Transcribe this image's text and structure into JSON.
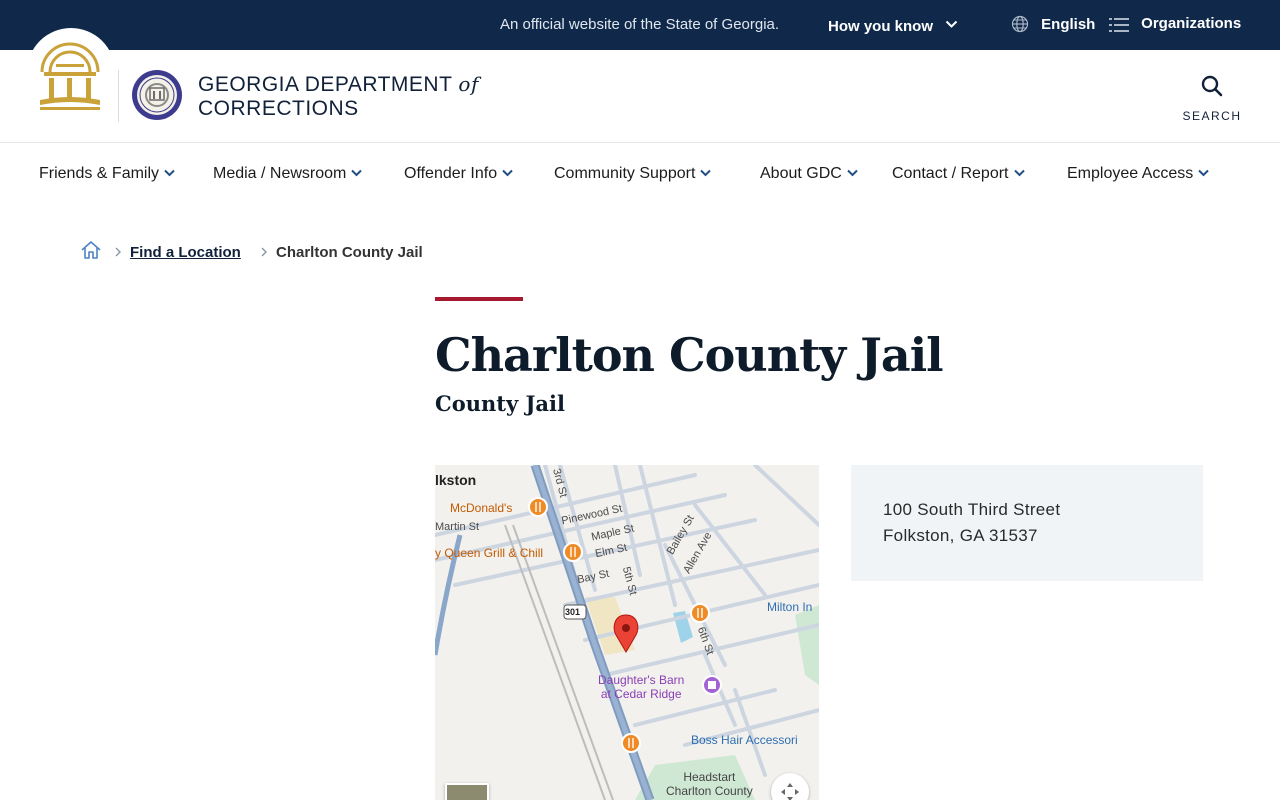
{
  "topbar": {
    "official_text": "An official website of the State of Georgia.",
    "how_you_know": "How you know",
    "language": "English",
    "organizations": "Organizations"
  },
  "header": {
    "agency_line1": "GEORGIA DEPARTMENT",
    "agency_of": "of",
    "agency_line2": "CORRECTIONS",
    "search_label": "SEARCH"
  },
  "nav": {
    "items": [
      {
        "label": "Friends & Family"
      },
      {
        "label": "Media / Newsroom"
      },
      {
        "label": "Offender Info"
      },
      {
        "label": "Community Support"
      },
      {
        "label": "About GDC"
      },
      {
        "label": "Contact / Report"
      },
      {
        "label": "Employee Access"
      }
    ]
  },
  "breadcrumb": {
    "parent": "Find a Location",
    "current": "Charlton County Jail"
  },
  "page": {
    "title": "Charlton County Jail",
    "subtitle": "County Jail"
  },
  "map": {
    "labels": {
      "town": "lkston",
      "mcdonalds": "McDonald's",
      "dairy_queen": "y Queen Grill & Chill",
      "martin_st": "Martin St",
      "pinewood_st": "Pinewood St",
      "maple_st": "Maple St",
      "elm_st": "Elm St",
      "bay_st": "Bay St",
      "third_st": "3rd St",
      "fifth_st": "5th St",
      "sixth_st": "6th St",
      "bailey_st": "Bailey St",
      "allen_ave": "Allen Ave",
      "milton": "Milton In",
      "highway": "301",
      "daughters_barn_1": "Daughter's Barn",
      "daughters_barn_2": "at Cedar Ridge",
      "boss_hair": "Boss Hair Accessori",
      "headstart_1": "Headstart",
      "headstart_2": "Charlton County"
    }
  },
  "address": {
    "street": "100 South Third Street",
    "city_state_zip": "Folkston, GA 31537"
  },
  "colors": {
    "topbar_bg": "#10294a",
    "accent_red": "#a6192e",
    "seal_gold": "#c9a23a",
    "badge_purple": "#3d3b8e",
    "nav_chevron": "#1f4e85"
  }
}
